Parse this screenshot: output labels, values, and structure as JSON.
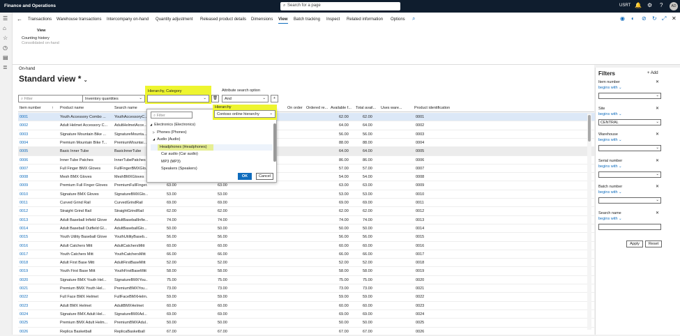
{
  "app": {
    "title": "Finance and Operations",
    "search_placeholder": "Search for a page",
    "company": "USRT",
    "avatar": "AD"
  },
  "tabs": [
    "Transactions",
    "Warehouse transactions",
    "Intercompany on-hand",
    "Quantity adjustment",
    "Released product details",
    "Dimensions",
    "View",
    "Batch tracking",
    "Inspect",
    "Related information",
    "Options"
  ],
  "view_group": {
    "title": "View",
    "item1": "Counting history",
    "item2": "Consolidated on-hand"
  },
  "page": {
    "caption": "On-hand",
    "view_title": "Standard view *"
  },
  "toolbar": {
    "filter_placeholder": "Filter",
    "quantities_select": "Inventory quantities",
    "hierarchy_category_label": "Hierarchy, Category",
    "attribute_search_label": "Attribute search option",
    "attribute_search_value": "And",
    "hierarchy_label": "Hierarchy",
    "hierarchy_value": "Contoso online hierarchy"
  },
  "grid": {
    "columns": [
      "Item number",
      "Product name",
      "Search name",
      "On order",
      "Ordered re...",
      "Available f...",
      "Total avail...",
      "Uses ware...",
      "Product identification"
    ],
    "rows": [
      {
        "id": "0001",
        "name": "Youth Accessory Combo ...",
        "search": "YouthAccessoryC...",
        "q1": "",
        "q2": "",
        "af": "62.00",
        "ta": "62.00",
        "pid": "0001"
      },
      {
        "id": "0002",
        "name": "Adult Helmet Accessory C...",
        "search": "AdultHelmetAcce...",
        "q1": "",
        "q2": "",
        "af": "64.00",
        "ta": "64.00",
        "pid": "0002"
      },
      {
        "id": "0003",
        "name": "Signature Mountain Bike ...",
        "search": "SignatureMounta...",
        "q1": "",
        "q2": "",
        "af": "56.00",
        "ta": "56.00",
        "pid": "0003"
      },
      {
        "id": "0004",
        "name": "Premium Mountain Bike T...",
        "search": "PremiumMountai...",
        "q1": "",
        "q2": "",
        "af": "88.00",
        "ta": "88.00",
        "pid": "0004"
      },
      {
        "id": "0005",
        "name": "Basic Inner Tube",
        "search": "BasicInnerTube",
        "q1": "",
        "q2": "",
        "af": "64.00",
        "ta": "64.00",
        "pid": "0005"
      },
      {
        "id": "0006",
        "name": "Inner Tube Patches",
        "search": "InnerTubePatches",
        "q1": "",
        "q2": "",
        "af": "86.00",
        "ta": "86.00",
        "pid": "0006"
      },
      {
        "id": "0007",
        "name": "Full Finger BMX Gloves",
        "search": "FullFingerBMXGlo...",
        "q1": "",
        "q2": "",
        "af": "57.00",
        "ta": "57.00",
        "pid": "0007"
      },
      {
        "id": "0008",
        "name": "Mesh BMX Gloves",
        "search": "MeshBMXGloves",
        "q1": "",
        "q2": "",
        "af": "54.00",
        "ta": "54.00",
        "pid": "0008"
      },
      {
        "id": "0009",
        "name": "Premium Full Finger Gloves",
        "search": "PremiumFullFinger...",
        "q1": "63.00",
        "q2": "63.00",
        "af": "63.00",
        "ta": "63.00",
        "pid": "0009"
      },
      {
        "id": "0010",
        "name": "Signature BMX Gloves",
        "search": "SignatureBMXGlo...",
        "q1": "53.00",
        "q2": "53.00",
        "af": "53.00",
        "ta": "53.00",
        "pid": "0010"
      },
      {
        "id": "0011",
        "name": "Curved Grind Rail",
        "search": "CurvedGrindRail",
        "q1": "69.00",
        "q2": "69.00",
        "af": "69.00",
        "ta": "69.00",
        "pid": "0011"
      },
      {
        "id": "0012",
        "name": "Straight Grind Rail",
        "search": "StraightGrindRail",
        "q1": "62.00",
        "q2": "62.00",
        "af": "62.00",
        "ta": "62.00",
        "pid": "0012"
      },
      {
        "id": "0013",
        "name": "Adult Baseball Infield Glove",
        "search": "AdultBaseballInfie...",
        "q1": "74.00",
        "q2": "74.00",
        "af": "74.00",
        "ta": "74.00",
        "pid": "0013"
      },
      {
        "id": "0014",
        "name": "Adult Baseball Outfield Gl...",
        "search": "AdultBaseballGlo...",
        "q1": "50.00",
        "q2": "50.00",
        "af": "50.00",
        "ta": "50.00",
        "pid": "0014"
      },
      {
        "id": "0015",
        "name": "Youth Utility Baseball Glove",
        "search": "YouthUtilityBaseb...",
        "q1": "56.00",
        "q2": "56.00",
        "af": "56.00",
        "ta": "56.00",
        "pid": "0015"
      },
      {
        "id": "0016",
        "name": "Adult Catchers Mitt",
        "search": "AdultCatchersMitt",
        "q1": "60.00",
        "q2": "60.00",
        "af": "60.00",
        "ta": "60.00",
        "pid": "0016"
      },
      {
        "id": "0017",
        "name": "Youth Catchers Mitt",
        "search": "YouthCatchersMitt",
        "q1": "66.00",
        "q2": "66.00",
        "af": "66.00",
        "ta": "66.00",
        "pid": "0017"
      },
      {
        "id": "0018",
        "name": "Adult First Base Mitt",
        "search": "AdultFirstBaseMitt",
        "q1": "52.00",
        "q2": "52.00",
        "af": "52.00",
        "ta": "52.00",
        "pid": "0018"
      },
      {
        "id": "0019",
        "name": "Youth First Base Mitt",
        "search": "YouthFirstBaseMitt",
        "q1": "58.00",
        "q2": "58.00",
        "af": "58.00",
        "ta": "58.00",
        "pid": "0019"
      },
      {
        "id": "0020",
        "name": "Signature BMX Youth Hel...",
        "search": "SignatureBMXYou...",
        "q1": "75.00",
        "q2": "75.00",
        "af": "75.00",
        "ta": "75.00",
        "pid": "0020"
      },
      {
        "id": "0021",
        "name": "Premium BMX Youth Hel...",
        "search": "PremiumBMXYou...",
        "q1": "73.00",
        "q2": "73.00",
        "af": "73.00",
        "ta": "73.00",
        "pid": "0021"
      },
      {
        "id": "0022",
        "name": "Full Face BMX Helmet",
        "search": "FullFaceBMXHelm...",
        "q1": "59.00",
        "q2": "59.00",
        "af": "59.00",
        "ta": "59.00",
        "pid": "0022"
      },
      {
        "id": "0023",
        "name": "Adult BMX Helmet",
        "search": "AdultBMXHelmet",
        "q1": "60.00",
        "q2": "60.00",
        "af": "60.00",
        "ta": "60.00",
        "pid": "0023"
      },
      {
        "id": "0024",
        "name": "Signature BMX Adult Hel...",
        "search": "SignatureBMXAd...",
        "q1": "69.00",
        "q2": "69.00",
        "af": "69.00",
        "ta": "69.00",
        "pid": "0024"
      },
      {
        "id": "0025",
        "name": "Premium BMX Adult Helm...",
        "search": "PremiumBMXAdul...",
        "q1": "50.00",
        "q2": "50.00",
        "af": "50.00",
        "ta": "50.00",
        "pid": "0025"
      },
      {
        "id": "0026",
        "name": "Replica Basketball",
        "search": "ReplicaBasketball",
        "q1": "67.00",
        "q2": "67.00",
        "af": "67.00",
        "ta": "67.00",
        "pid": "0026"
      }
    ]
  },
  "popup": {
    "filter_placeholder": "Filter",
    "tree": [
      {
        "label": "Electronics (Electronics)",
        "expander": "◢"
      },
      {
        "label": "Phones (Phones)",
        "expander": "▷"
      },
      {
        "label": "Audio (Audio)",
        "expander": "◢"
      },
      {
        "label": "Headphones (Headphones)",
        "expander": ""
      },
      {
        "label": "Car audio (Car audio)",
        "expander": ""
      },
      {
        "label": "MP3 (MP3)",
        "expander": ""
      },
      {
        "label": "Speakers (Speakers)",
        "expander": ""
      }
    ],
    "ok_label": "OK",
    "cancel_label": "Cancel"
  },
  "filters": {
    "title": "Filters",
    "add_label": "Add",
    "items": [
      {
        "label": "Item number",
        "op": "begins with",
        "value": ""
      },
      {
        "label": "Site",
        "op": "begins with",
        "value": "CENTRAL"
      },
      {
        "label": "Warehouse",
        "op": "begins with",
        "value": ""
      },
      {
        "label": "Serial number",
        "op": "begins with",
        "value": ""
      },
      {
        "label": "Batch number",
        "op": "begins with",
        "value": ""
      },
      {
        "label": "Search name",
        "op": "begins with",
        "value": ""
      }
    ],
    "apply_label": "Apply",
    "reset_label": "Reset"
  },
  "colors": {
    "topbar": "#0f1d2e",
    "highlight": "#eef52f",
    "accent": "#0f6cbd"
  }
}
